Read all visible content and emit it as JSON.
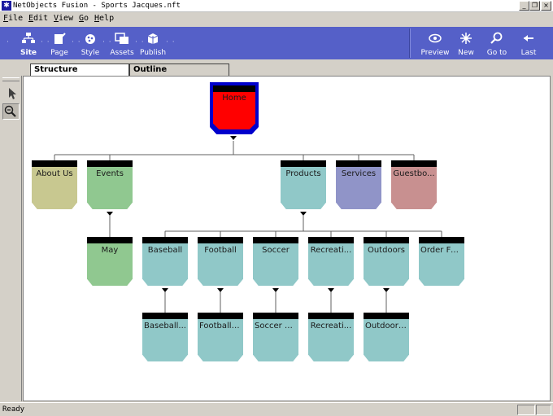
{
  "window": {
    "title": "NetObjects Fusion - Sports Jacques.nft",
    "controls": {
      "minimize": "_",
      "restore": "❐",
      "close": "×"
    }
  },
  "menu": [
    {
      "key": "F",
      "rest": "ile"
    },
    {
      "key": "E",
      "rest": "dit"
    },
    {
      "key": "V",
      "rest": "iew"
    },
    {
      "key": "G",
      "rest": "o"
    },
    {
      "key": "H",
      "rest": "elp"
    }
  ],
  "toolbar": {
    "views": [
      {
        "label": "Site",
        "icon": "site-icon",
        "selected": true
      },
      {
        "label": "Page",
        "icon": "page-icon"
      },
      {
        "label": "Style",
        "icon": "style-icon"
      },
      {
        "label": "Assets",
        "icon": "assets-icon"
      },
      {
        "label": "Publish",
        "icon": "publish-icon"
      }
    ],
    "nav": [
      {
        "label": "Preview",
        "icon": "preview-icon"
      },
      {
        "label": "New",
        "icon": "new-icon"
      },
      {
        "label": "Go to",
        "icon": "goto-icon"
      },
      {
        "label": "Last",
        "icon": "last-icon"
      }
    ],
    "colors": {
      "bg": "#5560c8"
    }
  },
  "tabs": [
    {
      "label": "Structure",
      "active": true
    },
    {
      "label": "Outline",
      "active": false
    }
  ],
  "site": {
    "home": {
      "label": "Home",
      "color": "#ff0000",
      "selected": true
    },
    "level1": [
      {
        "label": "About Us",
        "color": "#c8c890"
      },
      {
        "label": "Events",
        "color": "#90c890"
      },
      {
        "label": "Products",
        "color": "#90c8c8"
      },
      {
        "label": "Services",
        "color": "#9094c8"
      },
      {
        "label": "Guestbo...",
        "color": "#c89090"
      }
    ],
    "events_children": [
      {
        "label": "May",
        "color": "#90c890"
      }
    ],
    "products_children": [
      {
        "label": "Baseball",
        "color": "#90c8c8"
      },
      {
        "label": "Football",
        "color": "#90c8c8"
      },
      {
        "label": "Soccer",
        "color": "#90c8c8"
      },
      {
        "label": "Recreati...",
        "color": "#90c8c8"
      },
      {
        "label": "Outdoors",
        "color": "#90c8c8"
      },
      {
        "label": "Order Fo...",
        "color": "#90c8c8"
      }
    ],
    "level3": [
      {
        "label": "Baseball...",
        "color": "#90c8c8"
      },
      {
        "label": "Football ...",
        "color": "#90c8c8"
      },
      {
        "label": "Soccer E...",
        "color": "#90c8c8"
      },
      {
        "label": "Recreati...",
        "color": "#90c8c8"
      },
      {
        "label": "Outdoor ...",
        "color": "#90c8c8"
      }
    ]
  },
  "status": {
    "text": "Ready"
  }
}
